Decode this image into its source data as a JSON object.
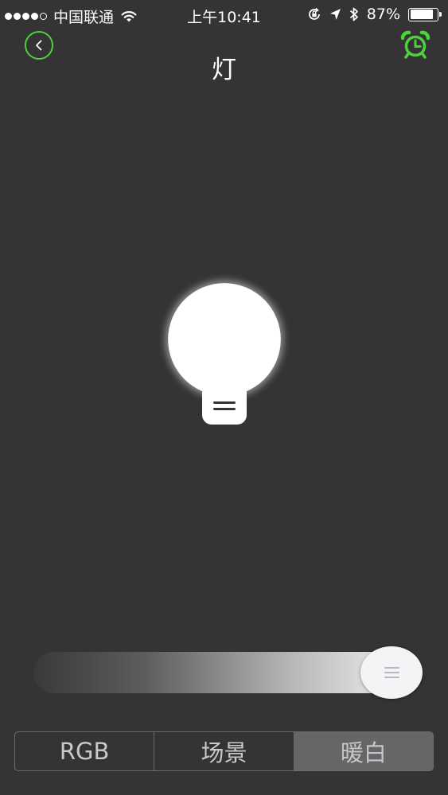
{
  "status_bar": {
    "carrier": "中国联通",
    "time": "上午10:41",
    "battery": "87%",
    "battery_level": 0.87,
    "icons": [
      "signal-dots-icon",
      "wifi-icon",
      "rotation-lock-icon",
      "location-arrow-icon",
      "bluetooth-icon",
      "battery-icon"
    ]
  },
  "header": {
    "title": "灯",
    "back_icon": "back-chevron-icon",
    "alarm_icon": "alarm-clock-icon",
    "accent_color": "#4cd23a"
  },
  "bulb": {
    "icon": "light-bulb-icon",
    "color": "#ffffff"
  },
  "slider": {
    "value": 1.0,
    "thumb_icon": "grip-icon"
  },
  "segments": {
    "items": [
      {
        "label": "RGB"
      },
      {
        "label": "场景"
      },
      {
        "label": "暖白"
      }
    ],
    "selected_index": 2
  },
  "colors": {
    "background": "#353335",
    "segment_active": "#676568",
    "segment_border": "#6c6a6d"
  }
}
